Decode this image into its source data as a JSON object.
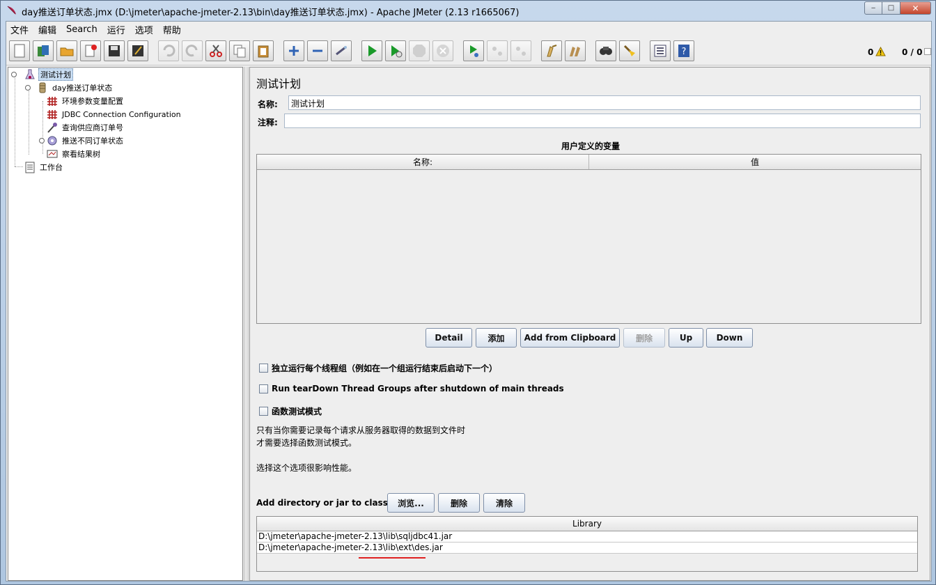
{
  "window": {
    "title": "day推送订单状态.jmx (D:\\jmeter\\apache-jmeter-2.13\\bin\\day推送订单状态.jmx) - Apache JMeter (2.13 r1665067)",
    "minimize": "‒",
    "maximize": "□",
    "close": "✕"
  },
  "menu": [
    "文件",
    "编辑",
    "Search",
    "运行",
    "选项",
    "帮助"
  ],
  "toolbar": {
    "buttons": [
      {
        "name": "new-icon"
      },
      {
        "name": "templates-icon"
      },
      {
        "name": "open-icon"
      },
      {
        "name": "close-file-icon"
      },
      {
        "name": "save-icon"
      },
      {
        "name": "save-as-icon"
      },
      {
        "name": "undo-icon"
      },
      {
        "name": "redo-icon"
      },
      {
        "name": "cut-icon"
      },
      {
        "name": "copy-icon"
      },
      {
        "name": "paste-icon"
      },
      {
        "name": "expand-icon"
      },
      {
        "name": "collapse-icon"
      },
      {
        "name": "toggle-icon"
      },
      {
        "name": "start-icon"
      },
      {
        "name": "start-no-pause-icon"
      },
      {
        "name": "stop-icon"
      },
      {
        "name": "shutdown-icon"
      },
      {
        "name": "remote-start-icon"
      },
      {
        "name": "remote-stop-icon"
      },
      {
        "name": "remote-shutdown-icon"
      },
      {
        "name": "clear-icon"
      },
      {
        "name": "clear-all-icon"
      },
      {
        "name": "search-icon"
      },
      {
        "name": "reset-search-icon"
      },
      {
        "name": "function-helper-icon"
      },
      {
        "name": "help-icon"
      }
    ],
    "error_count": "0",
    "thread_count": "0 / 0"
  },
  "tree": {
    "test_plan": "测试计划",
    "thread_group": "day推送订单状态",
    "children": [
      "环境参数变量配置",
      "JDBC Connection Configuration",
      "查询供应商订单号",
      "推送不同订单状态",
      "察看结果树"
    ],
    "workbench": "工作台"
  },
  "plan": {
    "title": "测试计划",
    "name_label": "名称:",
    "name_value": "测试计划",
    "comment_label": "注释:",
    "comment_value": "",
    "vars_title": "用户定义的变量",
    "vars_columns": [
      "名称:",
      "值"
    ],
    "buttons": [
      "Detail",
      "添加",
      "Add from Clipboard",
      "删除",
      "Up",
      "Down"
    ],
    "options": [
      "独立运行每个线程组（例如在一个组运行结束后启动下一个）",
      "Run tearDown Thread Groups after shutdown of main threads",
      "函数测试模式"
    ],
    "note_line1": "只有当你需要记录每个请求从服务器取得的数据到文件时",
    "note_line2": "才需要选择函数测试模式。",
    "note_line3": "选择这个选项很影响性能。",
    "classpath_label": "Add directory or jar to classpath",
    "classpath_buttons": [
      "浏览...",
      "删除",
      "清除"
    ],
    "library_header": "Library",
    "libraries": [
      "D:\\jmeter\\apache-jmeter-2.13\\lib\\sqljdbc41.jar",
      "D:\\jmeter\\apache-jmeter-2.13\\lib\\ext\\des.jar"
    ]
  },
  "colors": {
    "title_gradient": "#c7d8ec",
    "selection": "#c9ddf2",
    "underline": "#e02020"
  }
}
